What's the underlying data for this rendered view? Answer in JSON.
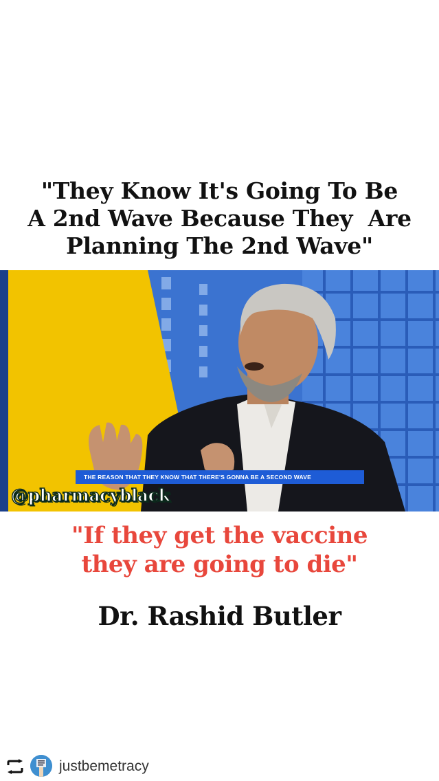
{
  "headline": {
    "line1": "\"They Know It's Going To Be",
    "line2": "A 2nd Wave Because They  Are",
    "line3": "Planning The 2nd Wave\""
  },
  "video": {
    "ticker_text": "THE REASON THAT THEY KNOW THAT THERE'S GONNA BE A SECOND WAVE",
    "watermark": "@pharmacyblack"
  },
  "quote": {
    "line1": "\"If they get the vaccine",
    "line2": "they are going to die\""
  },
  "speaker": "Dr. Rashid Butler",
  "repost": {
    "icon": "repost-icon",
    "username": "justbemetracy"
  },
  "colors": {
    "quote": "#e8473c",
    "ticker": "#1e5cd6",
    "yellow_panel": "#f2c300"
  }
}
